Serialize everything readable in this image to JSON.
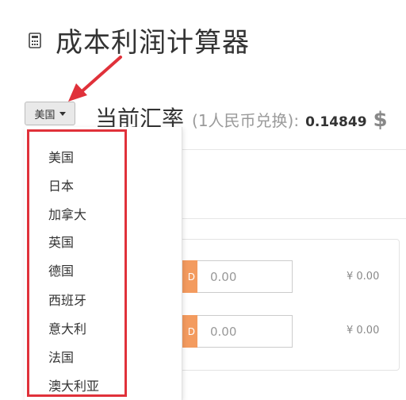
{
  "header": {
    "title": "成本利润计算器",
    "icon": "calculator-icon"
  },
  "country_select": {
    "selected": "美国",
    "options": [
      "美国",
      "日本",
      "加拿大",
      "英国",
      "德国",
      "西班牙",
      "意大利",
      "法国",
      "澳大利亚"
    ]
  },
  "rate": {
    "title": "当前汇率",
    "subtitle": "(1人民币兑换):",
    "value": "0.14849",
    "currency_symbol": "$"
  },
  "calc_rows": [
    {
      "addon": "D",
      "placeholder": "0.00",
      "result": "¥ 0.00"
    },
    {
      "addon": "D",
      "placeholder": "0.00",
      "result": "¥ 0.00"
    }
  ],
  "colors": {
    "highlight_border": "#e0313a",
    "arrow": "#e0313a",
    "input_addon": "#f39b5f"
  }
}
